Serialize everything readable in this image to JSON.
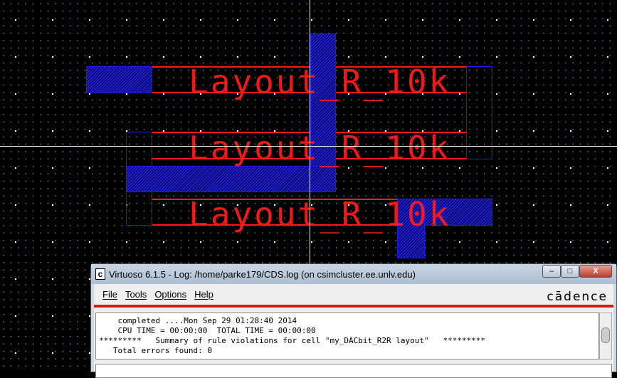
{
  "layout": {
    "labels": [
      "Layout_R_10k",
      "Layout_R_10k",
      "Layout_R_10k"
    ],
    "colors": {
      "metal": "#1a1aff",
      "resistor": "#ff1a1a",
      "background": "#000000"
    }
  },
  "window": {
    "title": "Virtuoso 6.1.5 - Log: /home/parke179/CDS.log (on csimcluster.ee.unlv.edu)",
    "app_icon": "c",
    "controls": {
      "minimize": "–",
      "maximize": "□",
      "close": "X"
    },
    "menu": [
      "File",
      "Tools",
      "Options",
      "Help"
    ],
    "logo": "cādence",
    "log_lines": [
      "    completed ....Mon Sep 29 01:28:40 2014",
      "    CPU TIME = 00:00:00  TOTAL TIME = 00:00:00",
      "*********   Summary of rule violations for cell \"my_DACbit_R2R layout\"   *********",
      "   Total errors found: 0"
    ]
  }
}
